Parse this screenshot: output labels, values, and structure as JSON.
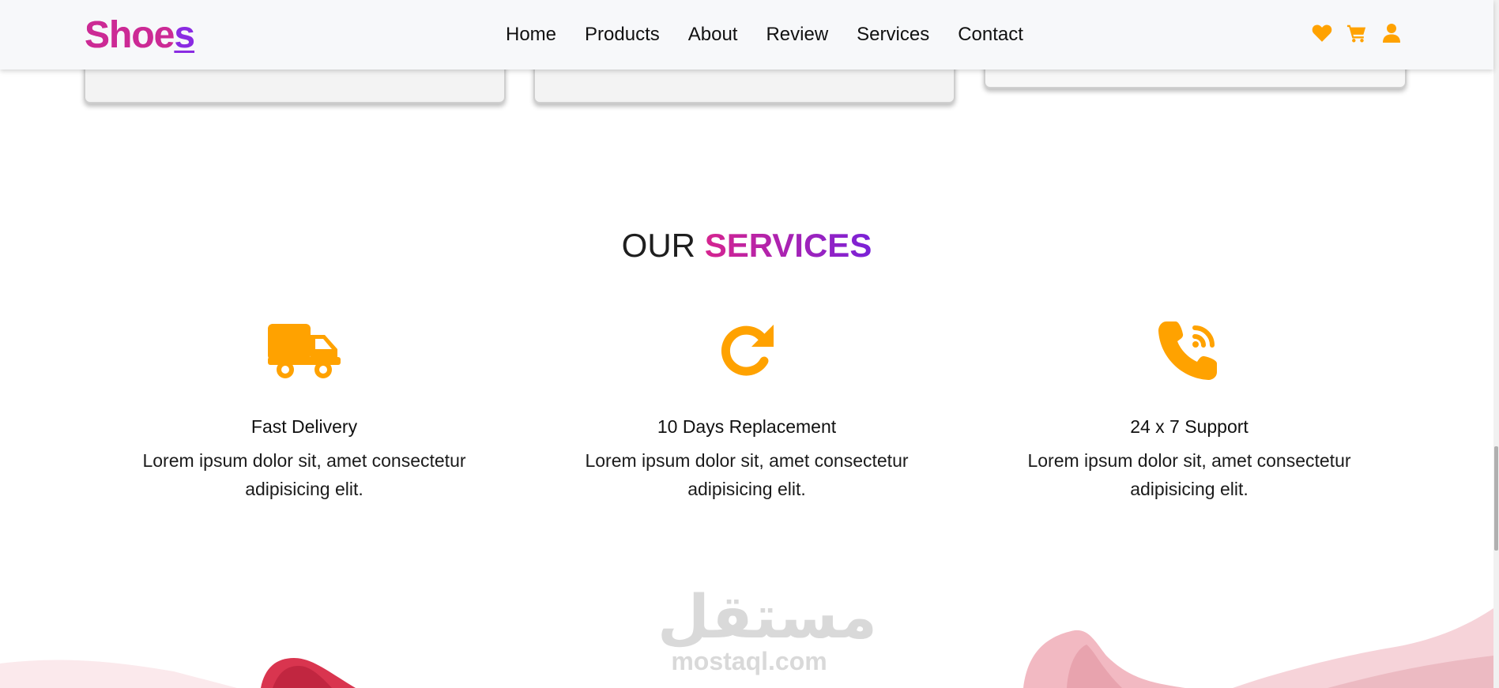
{
  "header": {
    "logo_main": "Shoe",
    "logo_last": "s",
    "nav": [
      "Home",
      "Products",
      "About",
      "Review",
      "Services",
      "Contact"
    ],
    "icons": [
      "heart-icon",
      "cart-icon",
      "user-icon"
    ]
  },
  "services_section": {
    "title_plain": "OUR",
    "title_accent": "SERVICES",
    "items": [
      {
        "icon": "truck-icon",
        "title": "Fast Delivery",
        "text": "Lorem ipsum dolor sit, amet consectetur adipisicing elit."
      },
      {
        "icon": "refresh-icon",
        "title": "10 Days Replacement",
        "text": "Lorem ipsum dolor sit, amet consectetur adipisicing elit."
      },
      {
        "icon": "phone-icon",
        "title": "24 x 7 Support",
        "text": "Lorem ipsum dolor sit, amet consectetur adipisicing elit."
      }
    ]
  },
  "watermark": {
    "arabic": "مستقل",
    "latin": "mostaql.com"
  },
  "colors": {
    "accent_orange": "#ffa200",
    "brand_pink": "#d6248f",
    "brand_purple": "#7a22d8",
    "header_bg": "#f7f8fa"
  }
}
